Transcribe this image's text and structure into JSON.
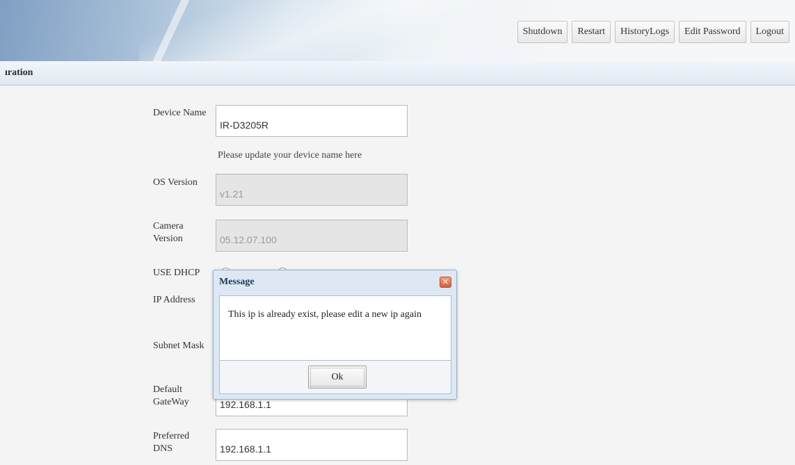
{
  "header": {
    "buttons": [
      "Shutdown",
      "Restart",
      "HistoryLogs",
      "Edit Password",
      "Logout"
    ]
  },
  "title_bar": {
    "text": "ıration"
  },
  "form": {
    "device_name_label": "Device Name",
    "device_name_value": "IR-D3205R",
    "device_name_hint": "Please update your device name here",
    "os_version_label": "OS Version",
    "os_version_value": "v1.21",
    "camera_version_label_line1": "Camera",
    "camera_version_label_line2": "Version",
    "camera_version_value": "05.12.07.100",
    "use_dhcp_label": "USE DHCP",
    "ip_address_label": "IP Address",
    "subnet_mask_label": "Subnet Mask",
    "default_gateway_label_line1": "Default",
    "default_gateway_label_line2": "GateWay",
    "default_gateway_value": "192.168.1.1",
    "preferred_dns_label_line1": "Preferred",
    "preferred_dns_label_line2": "DNS",
    "preferred_dns_value": "192.168.1.1"
  },
  "dialog": {
    "title": "Message",
    "message": "This ip is already exist,   please edit a new ip again",
    "ok_label": "Ok",
    "close_icon": "close-icon"
  }
}
